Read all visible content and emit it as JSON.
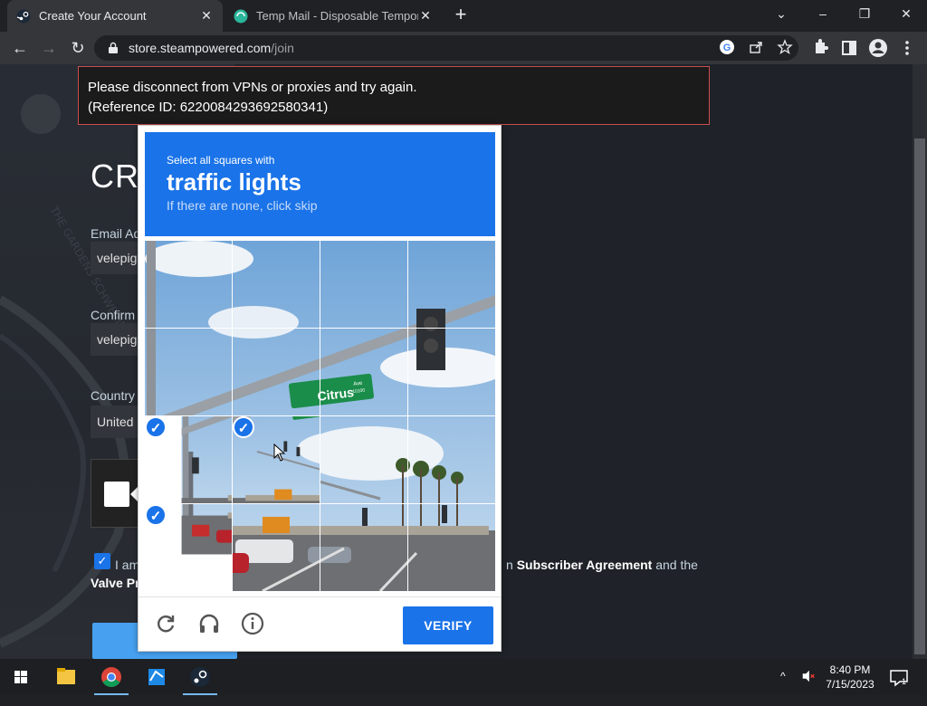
{
  "browser": {
    "tabs": [
      {
        "title": "Create Your Account",
        "active": true
      },
      {
        "title": "Temp Mail - Disposable Tempora",
        "active": false
      }
    ],
    "url_host": "store.steampowered.com",
    "url_path": "/join",
    "window_controls": {
      "minimize": "–",
      "restore": "❐",
      "close": "✕"
    }
  },
  "page": {
    "error_line1": "Please disconnect from VPNs or proxies and try again.",
    "error_line2": "(Reference ID: 6220084293692580341)",
    "heading": "CRE",
    "email_label": "Email Ad",
    "email_value": "velepig",
    "confirm_label": "Confirm",
    "confirm_value": "velepig",
    "country_label": "Country",
    "country_value": "United",
    "agree_left": "I am",
    "agree_link": "Subscriber Agreement",
    "agree_rest": " and the",
    "agree_line2": "Valve Pr",
    "agree_prefix": "n "
  },
  "captcha": {
    "instruction": "Select all squares with",
    "target": "traffic lights",
    "hint": "If there are none, click skip",
    "verify_label": "VERIFY",
    "selected_tiles": [
      8,
      9,
      12
    ],
    "street_sign": "Citrus",
    "street_sign_ave": "Ave",
    "street_sign_num": "10100"
  },
  "taskbar": {
    "time": "8:40 PM",
    "date": "7/15/2023",
    "notification_count": "1"
  },
  "colors": {
    "captcha_blue": "#1a73e8",
    "error_border": "#c94e4e",
    "steam_blue": "#47a1f0"
  }
}
